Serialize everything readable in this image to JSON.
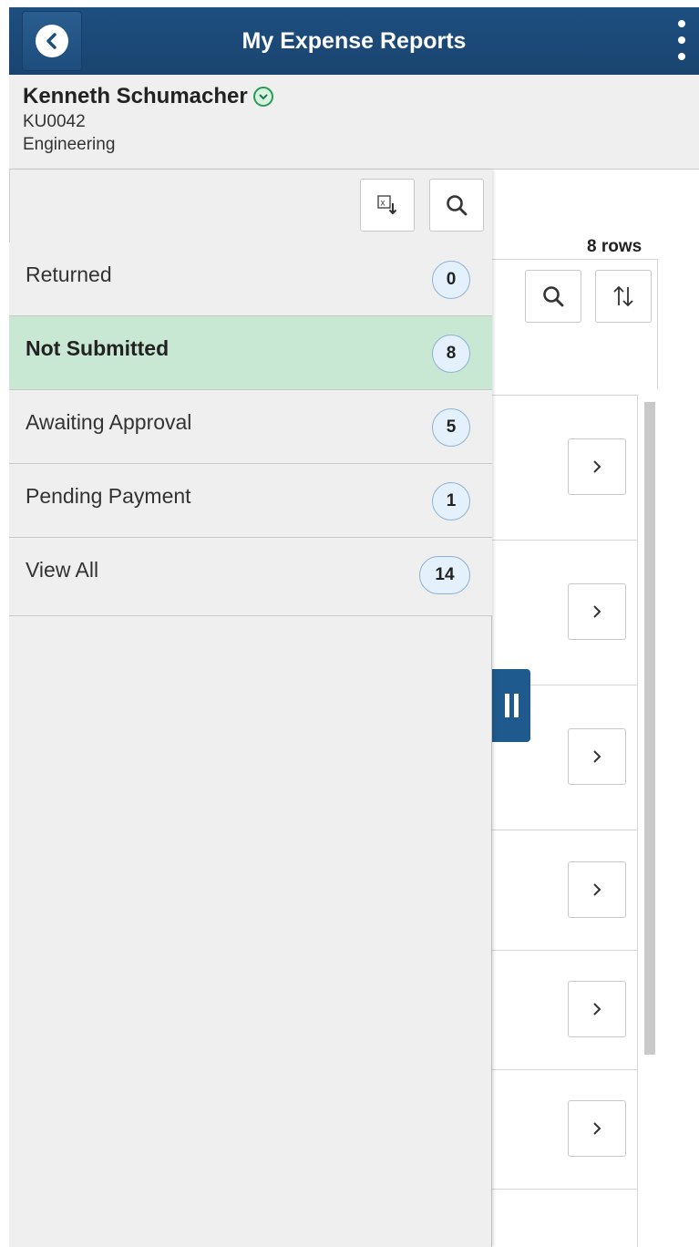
{
  "header": {
    "title": "My Expense Reports"
  },
  "user": {
    "name": "Kenneth Schumacher",
    "id": "KU0042",
    "department": "Engineering"
  },
  "main": {
    "rows_count": "8 rows",
    "row_count": 6
  },
  "panel": {
    "items": [
      {
        "label": "Returned",
        "count": "0"
      },
      {
        "label": "Not Submitted",
        "count": "8"
      },
      {
        "label": "Awaiting Approval",
        "count": "5"
      },
      {
        "label": "Pending Payment",
        "count": "1"
      },
      {
        "label": "View All",
        "count": "14"
      }
    ],
    "selected_index": 1
  },
  "colors": {
    "header": "#1a4470",
    "selected_row": "#c8e8d4",
    "badge": "#e4f0fb",
    "accent_green": "#2a9a58"
  },
  "icons": [
    "back-icon",
    "kebab-menu-icon",
    "dropdown-chevron-icon",
    "excel-export-icon",
    "search-icon",
    "sort-icon",
    "chevron-right-icon",
    "pause-icon"
  ]
}
